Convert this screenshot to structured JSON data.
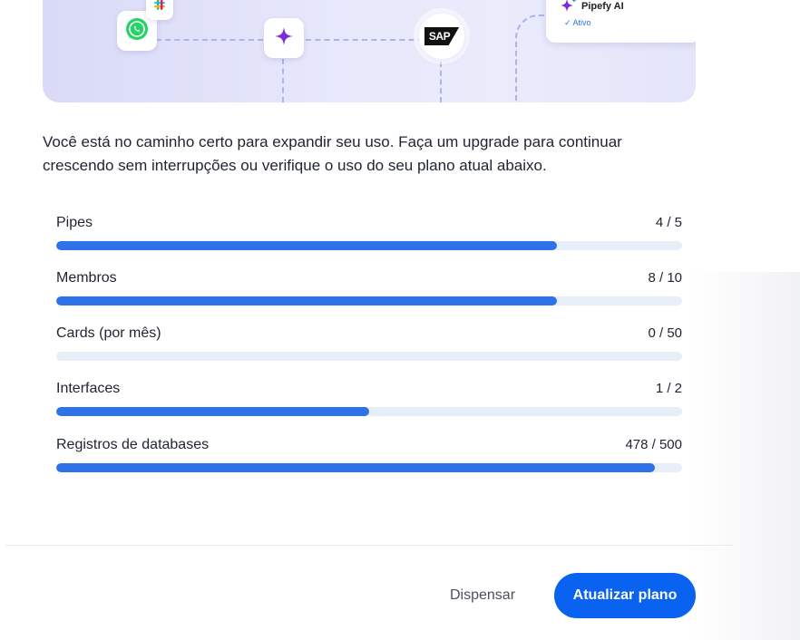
{
  "hero": {
    "ai_card": {
      "name": "Pipefy AI",
      "status": "✓ Ativo"
    },
    "sap_label": "SAP",
    "whatsapp_label": "WhatsApp",
    "slack_label": "Slack"
  },
  "intro_text": "Você está no caminho certo para expandir seu uso. Faça um upgrade para continuar crescendo sem interrupções ou verifique o uso do seu plano atual abaixo.",
  "usage": [
    {
      "label": "Pipes",
      "value_text": "4 / 5",
      "used": 4,
      "limit": 5
    },
    {
      "label": "Membros",
      "value_text": "8 / 10",
      "used": 8,
      "limit": 10
    },
    {
      "label": "Cards (por mês)",
      "value_text": "0 / 50",
      "used": 0,
      "limit": 50
    },
    {
      "label": "Interfaces",
      "value_text": "1 / 2",
      "used": 1,
      "limit": 2
    },
    {
      "label": "Registros de databases",
      "value_text": "478 / 500",
      "used": 478,
      "limit": 500
    }
  ],
  "footer": {
    "dismiss_label": "Dispensar",
    "upgrade_label": "Atualizar plano"
  },
  "colors": {
    "accent": "#0a63f0",
    "progress_fill": "#2e72ea",
    "progress_track": "#e8eef8",
    "ai_purple": "#7b2cd6"
  },
  "icons": {
    "whatsapp": "whatsapp-icon",
    "slack": "slack-icon",
    "ai_sparkle": "sparkle-icon",
    "sap": "sap-logo"
  }
}
